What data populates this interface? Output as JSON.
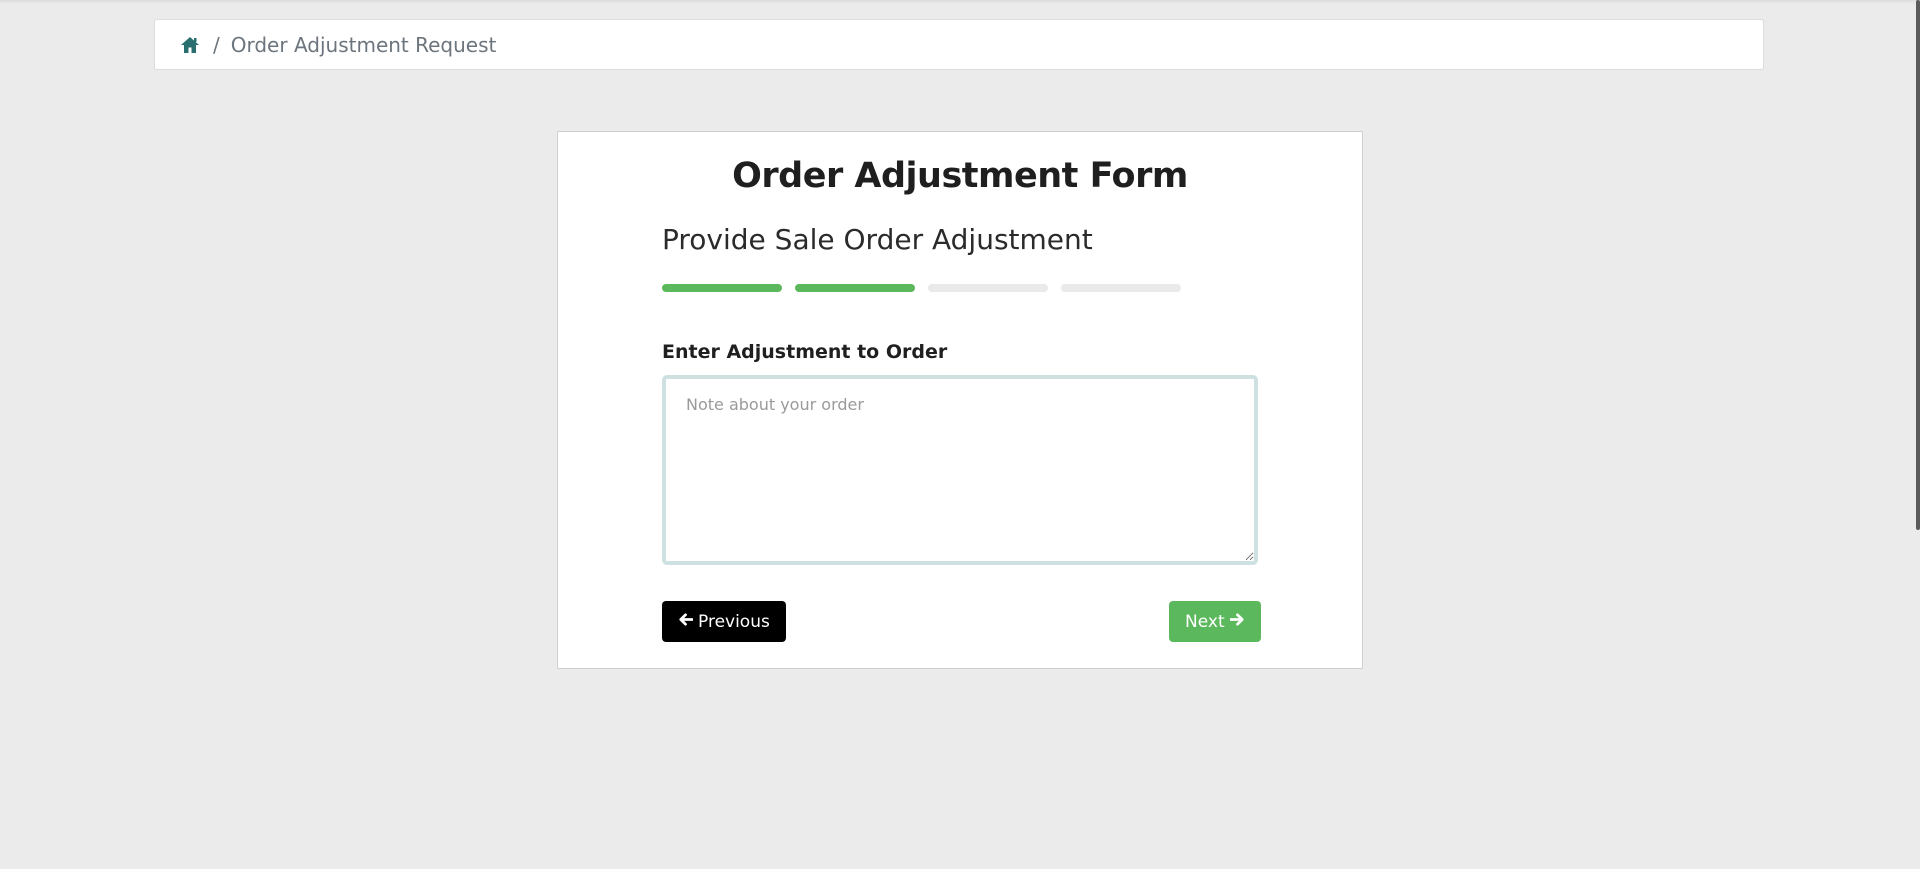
{
  "breadcrumb": {
    "home_icon": "home-icon",
    "separator": "/",
    "current": "Order Adjustment Request"
  },
  "form": {
    "title": "Order Adjustment Form",
    "step_title": "Provide Sale Order Adjustment",
    "progress": {
      "total_steps": 4,
      "completed_steps": 2
    },
    "field_label": "Enter Adjustment to Order",
    "note_placeholder": "Note about your order",
    "note_value": "",
    "previous_label": "Previous",
    "next_label": "Next"
  },
  "colors": {
    "accent": "#5cb85c",
    "page_bg": "#ebebeb",
    "breadcrumb_icon": "#2a6f6f"
  }
}
